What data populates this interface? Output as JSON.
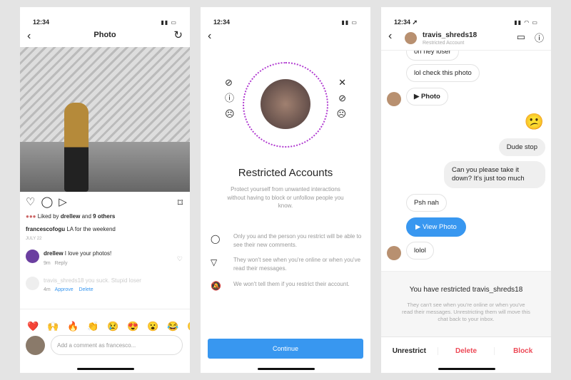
{
  "status_time": "12:34",
  "post": {
    "title": "Photo",
    "liked_prefix": "Liked by ",
    "liked_user": "drellew",
    "liked_and": " and ",
    "liked_others": "9 others",
    "caption_user": "francescofogu",
    "caption_text": " LA for the weekend",
    "date": "JULY 22",
    "comments": [
      {
        "user": "drellew",
        "text": " I love your photos!",
        "time": "9m",
        "action1": "Reply"
      },
      {
        "user": "travis_shreds18",
        "text": " you suck. Stupid loser",
        "time": "4m",
        "action1": "Approve",
        "action2": "Delete"
      }
    ],
    "emojis": [
      "❤️",
      "🙌",
      "🔥",
      "👏",
      "😢",
      "😍",
      "😮",
      "😂",
      "😐"
    ],
    "comment_placeholder": "Add a comment as francesco..."
  },
  "restrict": {
    "title": "Restricted Accounts",
    "subtitle": "Protect yourself from unwanted interactions without having to block or unfollow people you know.",
    "items": [
      {
        "icon": "comment-icon",
        "text": "Only you and the person you restrict will be able to see their new comments."
      },
      {
        "icon": "direct-icon",
        "text": "They won't see when you're online or when you've read their messages."
      },
      {
        "icon": "bell-off-icon",
        "text": "We won't tell them if you restrict their account."
      }
    ],
    "continue": "Continue",
    "accent": "#3897f0"
  },
  "chat": {
    "username": "travis_shreds18",
    "subtitle": "Restricted Account",
    "messages": [
      {
        "from": "them",
        "text": "oh hey loser"
      },
      {
        "from": "them",
        "text": "lol check this photo"
      },
      {
        "from": "them",
        "text": "▶ Photo"
      },
      {
        "from": "me",
        "text": "😕"
      },
      {
        "from": "me",
        "text": "Dude stop"
      },
      {
        "from": "me",
        "text": "Can you please take it down? It's just too much"
      },
      {
        "from": "them",
        "text": "Psh nah"
      },
      {
        "from": "them",
        "text": "▶ View Photo"
      },
      {
        "from": "them",
        "text": "lolol"
      }
    ],
    "notice_title": "You have restricted travis_shreds18",
    "notice_text": "They can't see when you're online or when you've read their messages. Unrestricting them will move this chat back to your inbox.",
    "actions": [
      "Unrestrict",
      "Delete",
      "Block"
    ],
    "danger": "#ed4956"
  }
}
